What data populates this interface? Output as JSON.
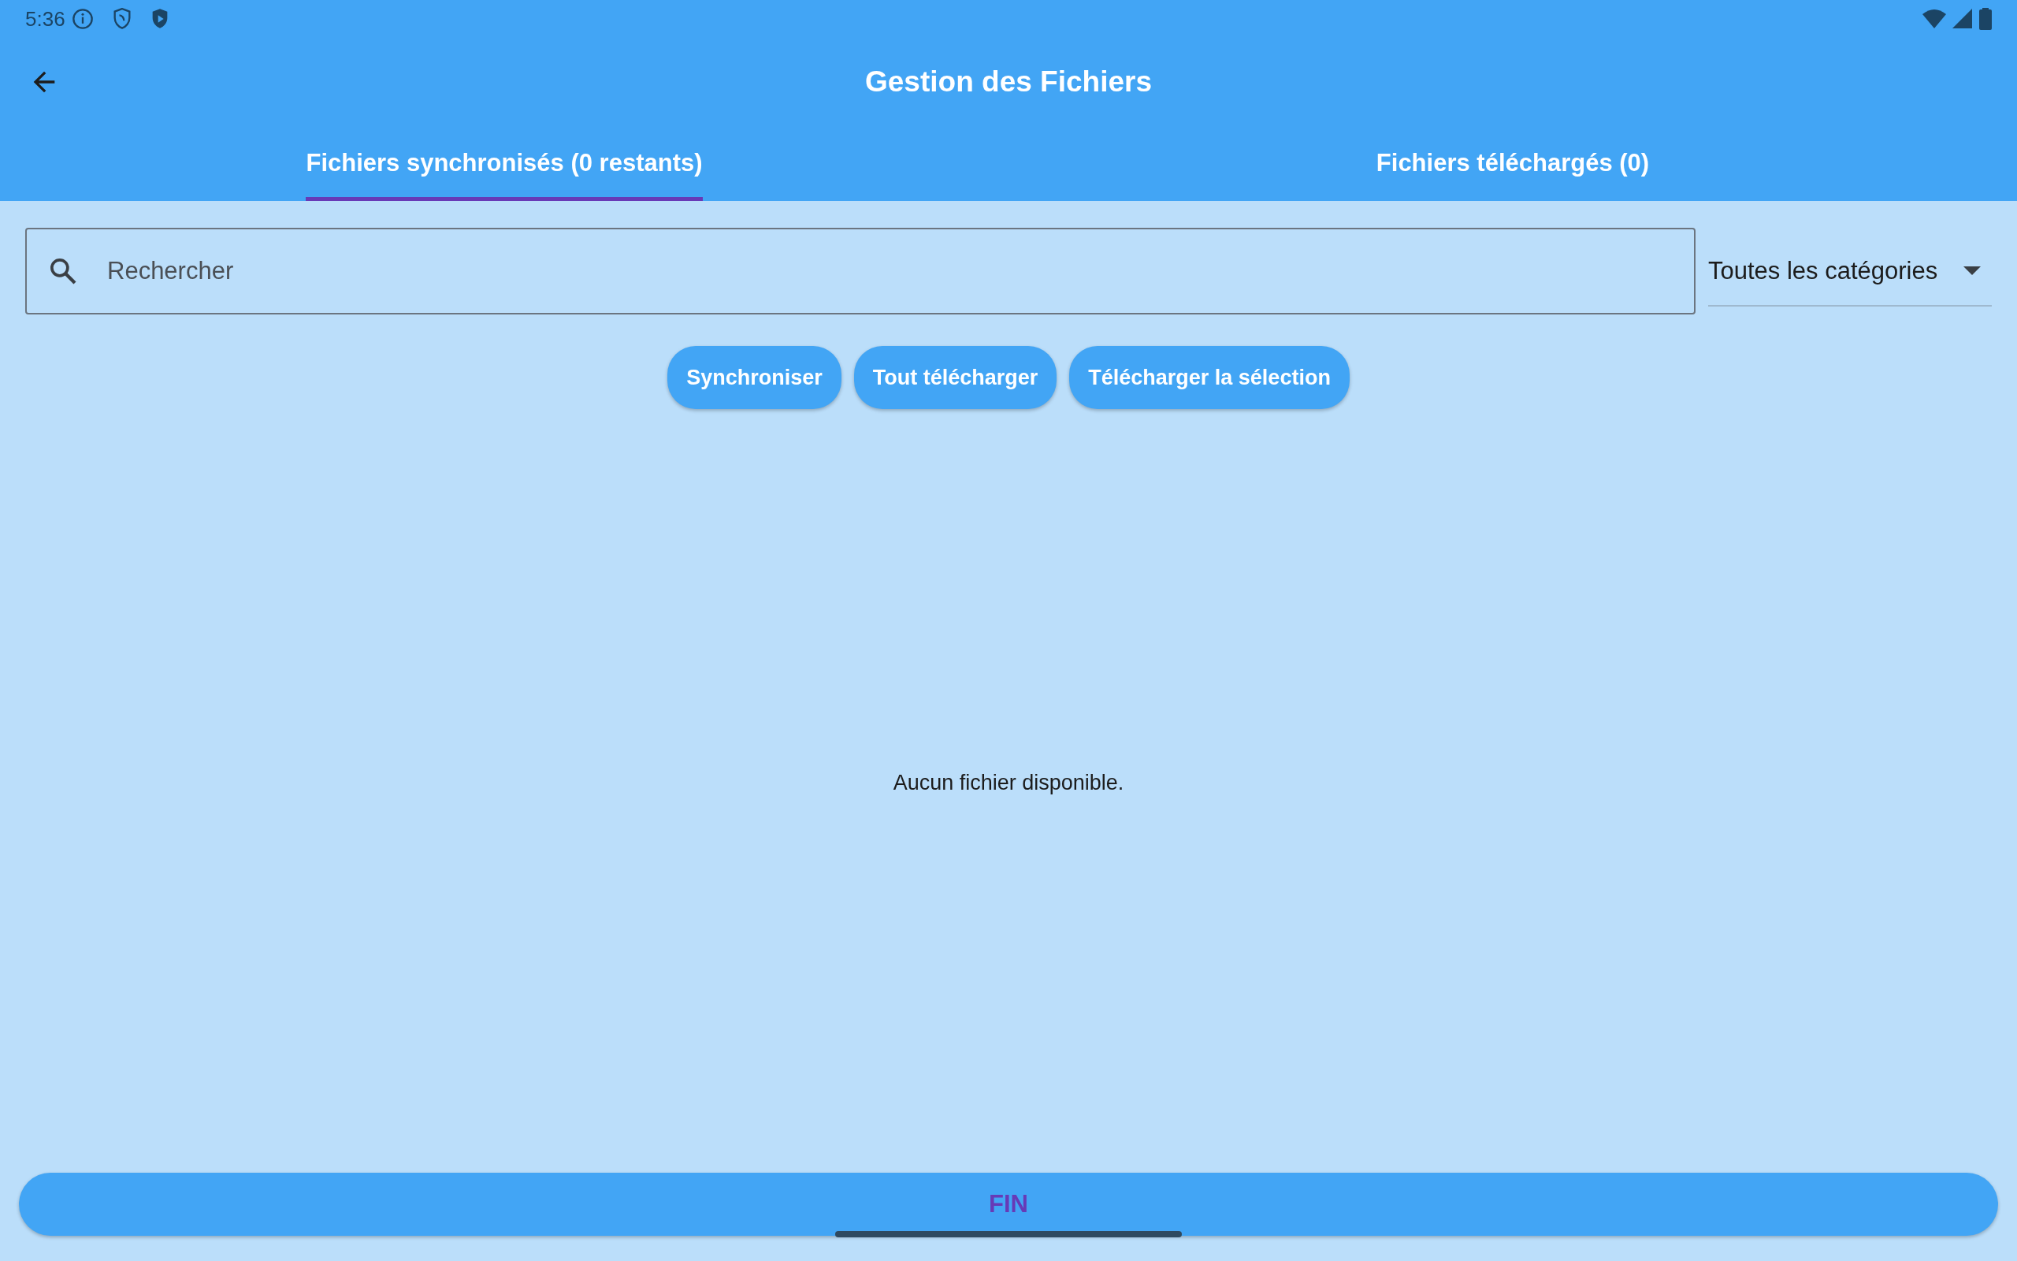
{
  "status_bar": {
    "time": "5:36"
  },
  "app_bar": {
    "title": "Gestion des Fichiers"
  },
  "tabs": [
    {
      "label": "Fichiers synchronisés (0 restants)",
      "selected": true
    },
    {
      "label": "Fichiers téléchargés (0)",
      "selected": false
    }
  ],
  "search": {
    "placeholder": "Rechercher"
  },
  "category_filter": {
    "value": "Toutes les catégories"
  },
  "buttons": [
    "Synchroniser",
    "Tout télécharger",
    "Télécharger la sélection"
  ],
  "empty_message": "Aucun fichier disponible.",
  "bottom_button": "FIN"
}
